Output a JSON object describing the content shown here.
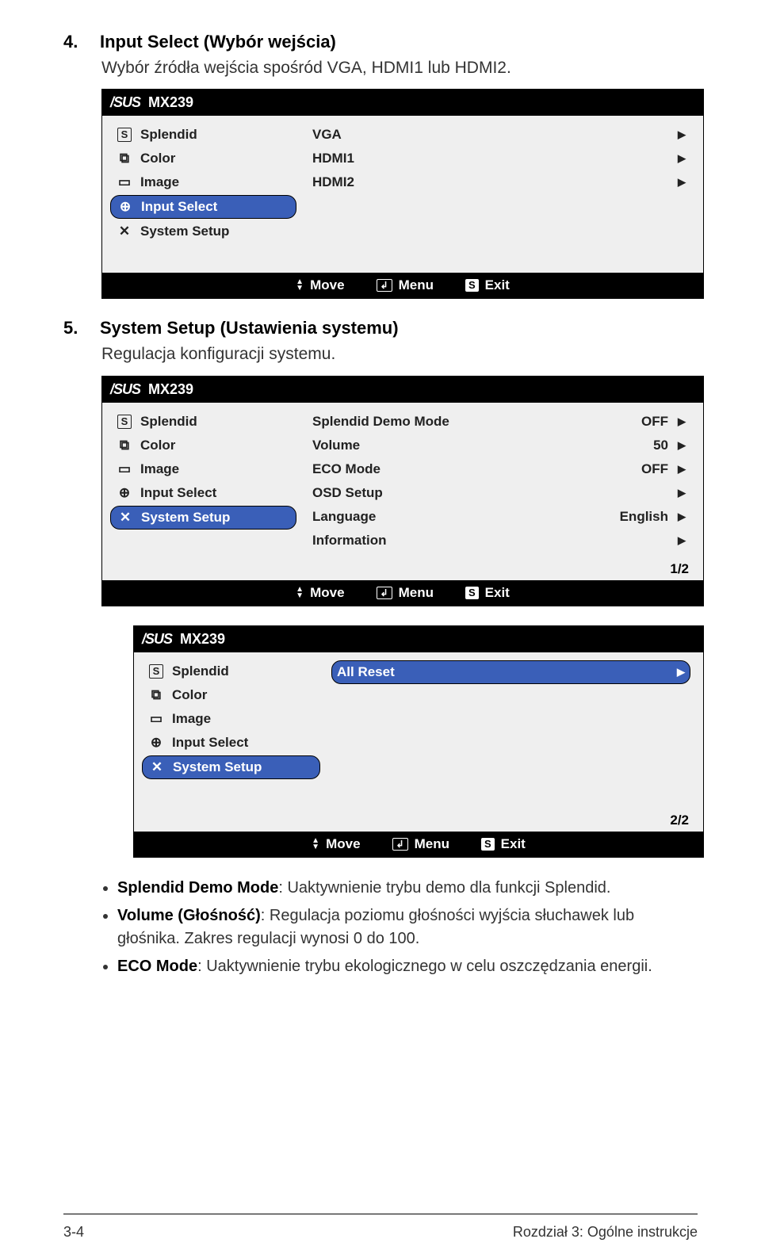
{
  "section4": {
    "num": "4.",
    "title": "Input Select (Wybór wejścia)",
    "desc": "Wybór źródła wejścia spośród VGA, HDMI1 lub HDMI2."
  },
  "section5": {
    "num": "5.",
    "title": "System Setup (Ustawienia systemu)",
    "desc": "Regulacja konfiguracji systemu."
  },
  "osd_common": {
    "logo": "/SUS",
    "model": "MX239",
    "move": "Move",
    "menu": "Menu",
    "exit": "Exit"
  },
  "sidebar": {
    "splendid": "Splendid",
    "color": "Color",
    "image": "Image",
    "input_select": "Input Select",
    "system_setup": "System Setup"
  },
  "osd1": {
    "vga": "VGA",
    "hdmi1": "HDMI1",
    "hdmi2": "HDMI2"
  },
  "osd2": {
    "splendid_demo": "Splendid Demo Mode",
    "splendid_demo_val": "OFF",
    "volume": "Volume",
    "volume_val": "50",
    "eco": "ECO Mode",
    "eco_val": "OFF",
    "osd_setup": "OSD Setup",
    "language": "Language",
    "language_val": "English",
    "information": "Information",
    "page": "1/2"
  },
  "osd3": {
    "all_reset": "All Reset",
    "page": "2/2"
  },
  "bullets": {
    "b1_label": "Splendid Demo Mode",
    "b1_text": ": Uaktywnienie trybu demo dla funkcji Splendid.",
    "b2_label": "Volume (Głośność)",
    "b2_text": ": Regulacja poziomu głośności wyjścia słuchawek lub głośnika. Zakres regulacji wynosi 0 do 100.",
    "b3_label": "ECO Mode",
    "b3_text": ": Uaktywnienie trybu ekologicznego w celu oszczędzania energii."
  },
  "footer": {
    "left": "3-4",
    "right": "Rozdział 3: Ogólne instrukcje"
  }
}
